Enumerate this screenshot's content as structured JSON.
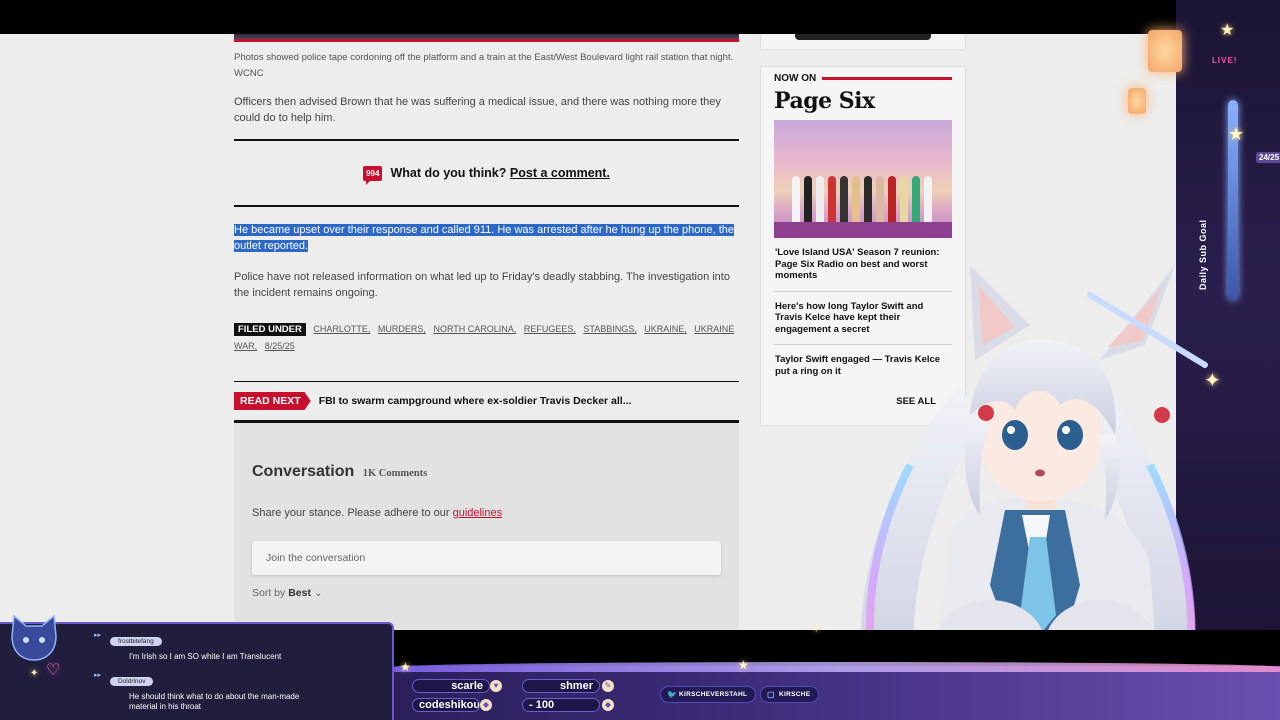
{
  "article": {
    "caption": "Photos showed police tape cordoning off the platform and a train at the East/West Boulevard light rail station that night.",
    "caption_credit": "WCNC",
    "para1": "Officers then advised Brown that he was suffering a medical issue, and there was nothing more they could do to help him.",
    "comment_count": "994",
    "comment_question": "What do you think?",
    "comment_link": "Post a comment.",
    "highlighted_para": "He became upset over their response and called 911. He was arrested after he hung up the phone, the outlet reported.",
    "para3": "Police have not released information on what led up to Friday's deadly stabbing. The investigation into the incident remains ongoing.",
    "filed_under_label": "FILED UNDER",
    "tags": [
      "CHARLOTTE,",
      "MURDERS,",
      "NORTH CAROLINA,",
      "REFUGEES,",
      "STABBINGS,",
      "UKRAINE,",
      "UKRAINE WAR,",
      "8/25/25"
    ],
    "read_next_label": "READ NEXT",
    "read_next_title": "FBI to swarm campground where ex-soldier Travis Decker all..."
  },
  "conversation": {
    "title": "Conversation",
    "count": "1K Comments",
    "prompt": "Share your stance. Please adhere to our",
    "guidelines_link": "guidelines",
    "input_placeholder": "Join the conversation",
    "sort_label": "Sort by",
    "sort_value": "Best"
  },
  "sidebar": {
    "now_on": "NOW ON",
    "brand": "Page Six",
    "stories": [
      "'Love Island USA' Season 7 reunion: Page Six Radio on best and worst moments",
      "Here's how long Taylor Swift and Travis Kelce have kept their engagement a secret",
      "Taylor Swift engaged — Travis Kelce put a ring on it"
    ],
    "see_all": "SEE ALL"
  },
  "chat": {
    "messages": [
      {
        "user": "frostbitefang",
        "text": "I'm Irish so I am SO white I am Translucent"
      },
      {
        "user": "Doldrinov",
        "text": "He should think what to do about the man-made material in his throat"
      }
    ]
  },
  "overlay": {
    "goal_label": "Daily Sub Goal",
    "goal_count": "24/25",
    "live": "LIVE!",
    "ticker": [
      "scarle",
      "shmer",
      "codeshikou",
      "- 100"
    ],
    "socials": [
      "KIRSCHEVERSTAHL",
      "KIRSCHE"
    ]
  },
  "colors": {
    "brand_red": "#c8102e",
    "selection_blue": "#2b68c8",
    "overlay_purple": "#2b1f5a"
  }
}
